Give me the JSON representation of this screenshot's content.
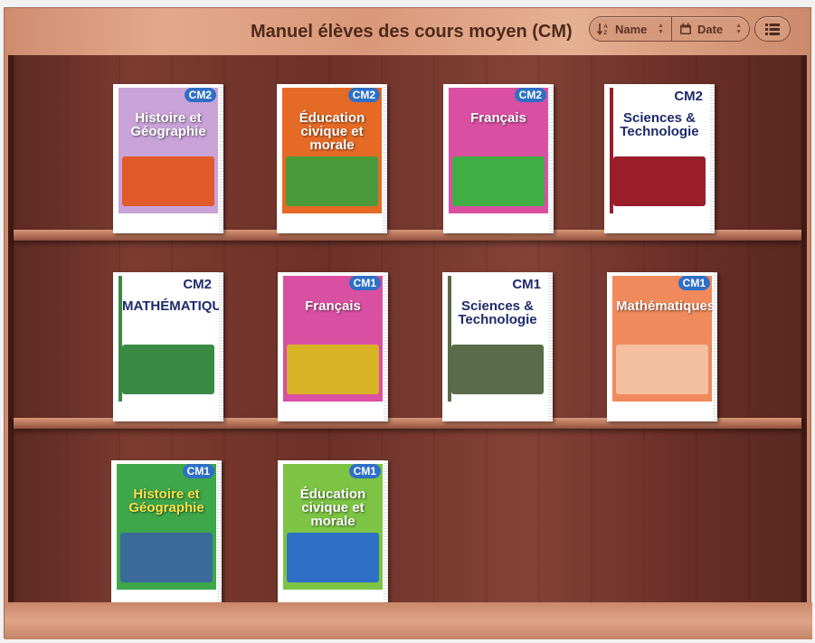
{
  "header": {
    "title": "Manuel élèves des cours moyen (CM)",
    "sort_name_label": "Name",
    "sort_date_label": "Date"
  },
  "icons": {
    "sort_name": "sort-alpha-icon",
    "sort_date": "calendar-icon",
    "view": "list-icon"
  },
  "books": [
    {
      "level": "CM2",
      "title": "Histoire et Géographie",
      "cover_color": "#c9a3d8",
      "title_color": "#ffffff",
      "art_color": "#e05a2a"
    },
    {
      "level": "CM2",
      "title": "Éducation civique et morale",
      "cover_color": "#e56a26",
      "title_color": "#ffffff",
      "art_color": "#4a9a3c"
    },
    {
      "level": "CM2",
      "title": "Français",
      "cover_color": "#d94fa2",
      "title_color": "#ffffff",
      "art_color": "#3fae44"
    },
    {
      "level": "CM2",
      "title": "Sciences & Technologie",
      "cover_color": "#ffffff",
      "title_color": "#1e2a6a",
      "art_color": "#9a1e2a"
    },
    {
      "level": "CM2",
      "title": "MATHÉMATIQUES",
      "cover_color": "#ffffff",
      "title_color": "#1e2a6a",
      "art_color": "#3a8a46"
    },
    {
      "level": "CM1",
      "title": "Français",
      "cover_color": "#d94fa2",
      "title_color": "#ffffff",
      "art_color": "#d8b326"
    },
    {
      "level": "CM1",
      "title": "Sciences & Technologie",
      "cover_color": "#ffffff",
      "title_color": "#1e2a6a",
      "art_color": "#5b6b4a"
    },
    {
      "level": "CM1",
      "title": "Mathématiques",
      "cover_color": "#f08a5c",
      "title_color": "#ffffff",
      "art_color": "#f5c0a0"
    },
    {
      "level": "CM1",
      "title": "Histoire et Géographie",
      "cover_color": "#3ea74a",
      "title_color": "#f5e04a",
      "art_color": "#3a6a9a"
    },
    {
      "level": "CM1",
      "title": "Éducation civique et morale",
      "cover_color": "#7dc444",
      "title_color": "#ffffff",
      "art_color": "#2f6fc6"
    }
  ]
}
